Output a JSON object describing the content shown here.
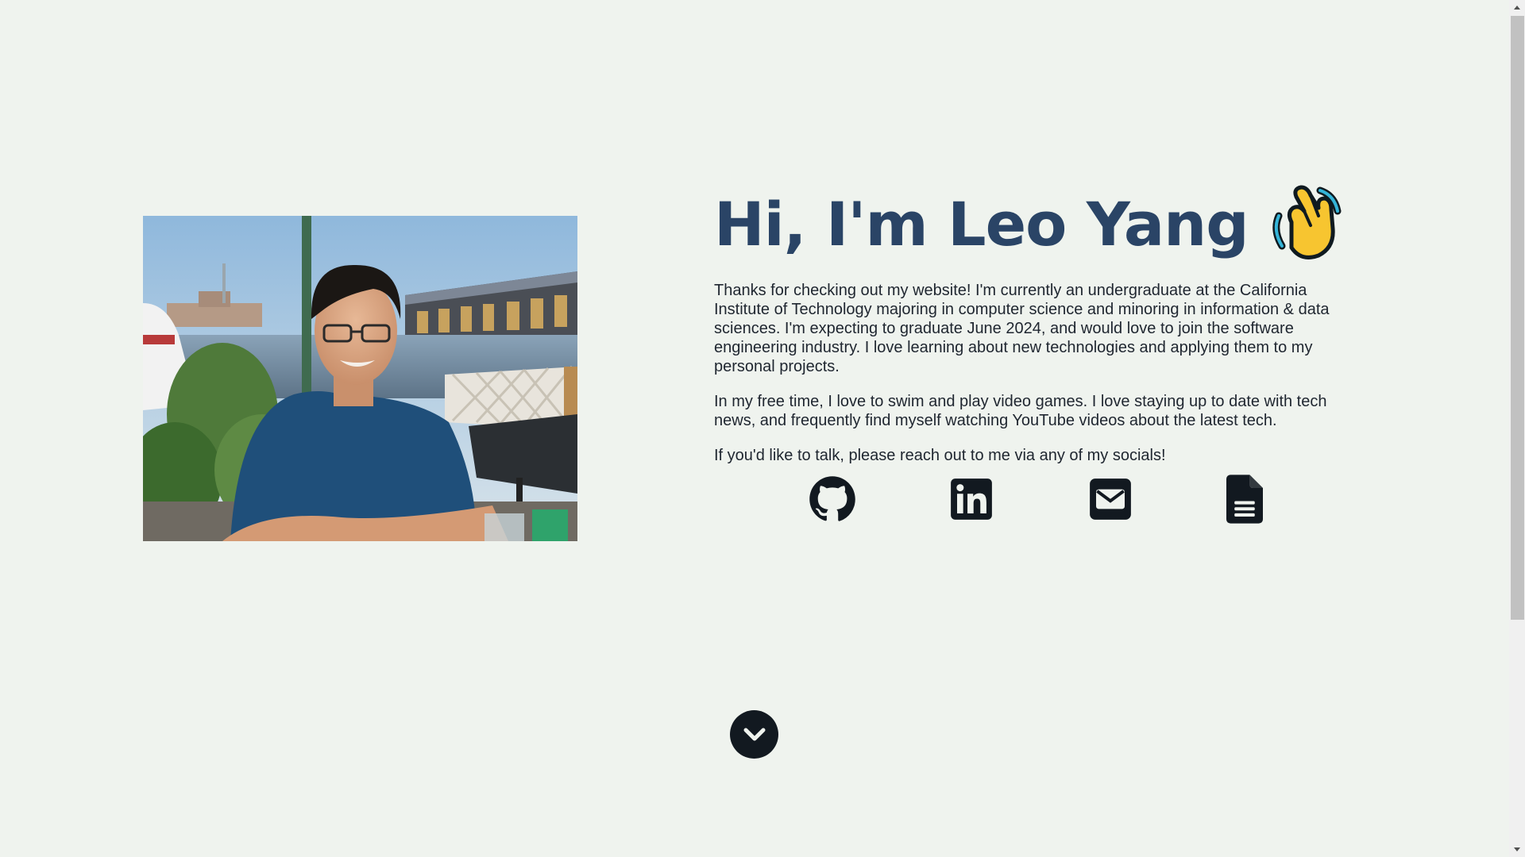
{
  "profile": {
    "photo_alt": "Leo Yang sitting at a waterfront table",
    "heading": "Hi, I'm Leo Yang",
    "paragraphs": [
      "Thanks for checking out my website! I'm currently an undergraduate at the California Institute of Technology majoring in computer science and minoring in information & data sciences. I'm expecting to graduate June 2024, and would love to join the software engineering industry. I love learning about new technologies and applying them to my personal projects.",
      "In my free time, I love to swim and play video games. I love staying up to date with tech news, and frequently find myself watching YouTube videos about the latest tech.",
      "If you'd like to talk, please reach out to me via any of my socials!"
    ]
  },
  "socials": [
    {
      "icon": "github-icon"
    },
    {
      "icon": "linkedin-icon"
    },
    {
      "icon": "email-icon"
    },
    {
      "icon": "resume-document-icon"
    }
  ],
  "scroll_down": {
    "icon": "chevron-down-icon"
  },
  "colors": {
    "background": "#eff3ee",
    "heading": "#2a4466",
    "text": "#1f2630",
    "icon": "#121920"
  }
}
